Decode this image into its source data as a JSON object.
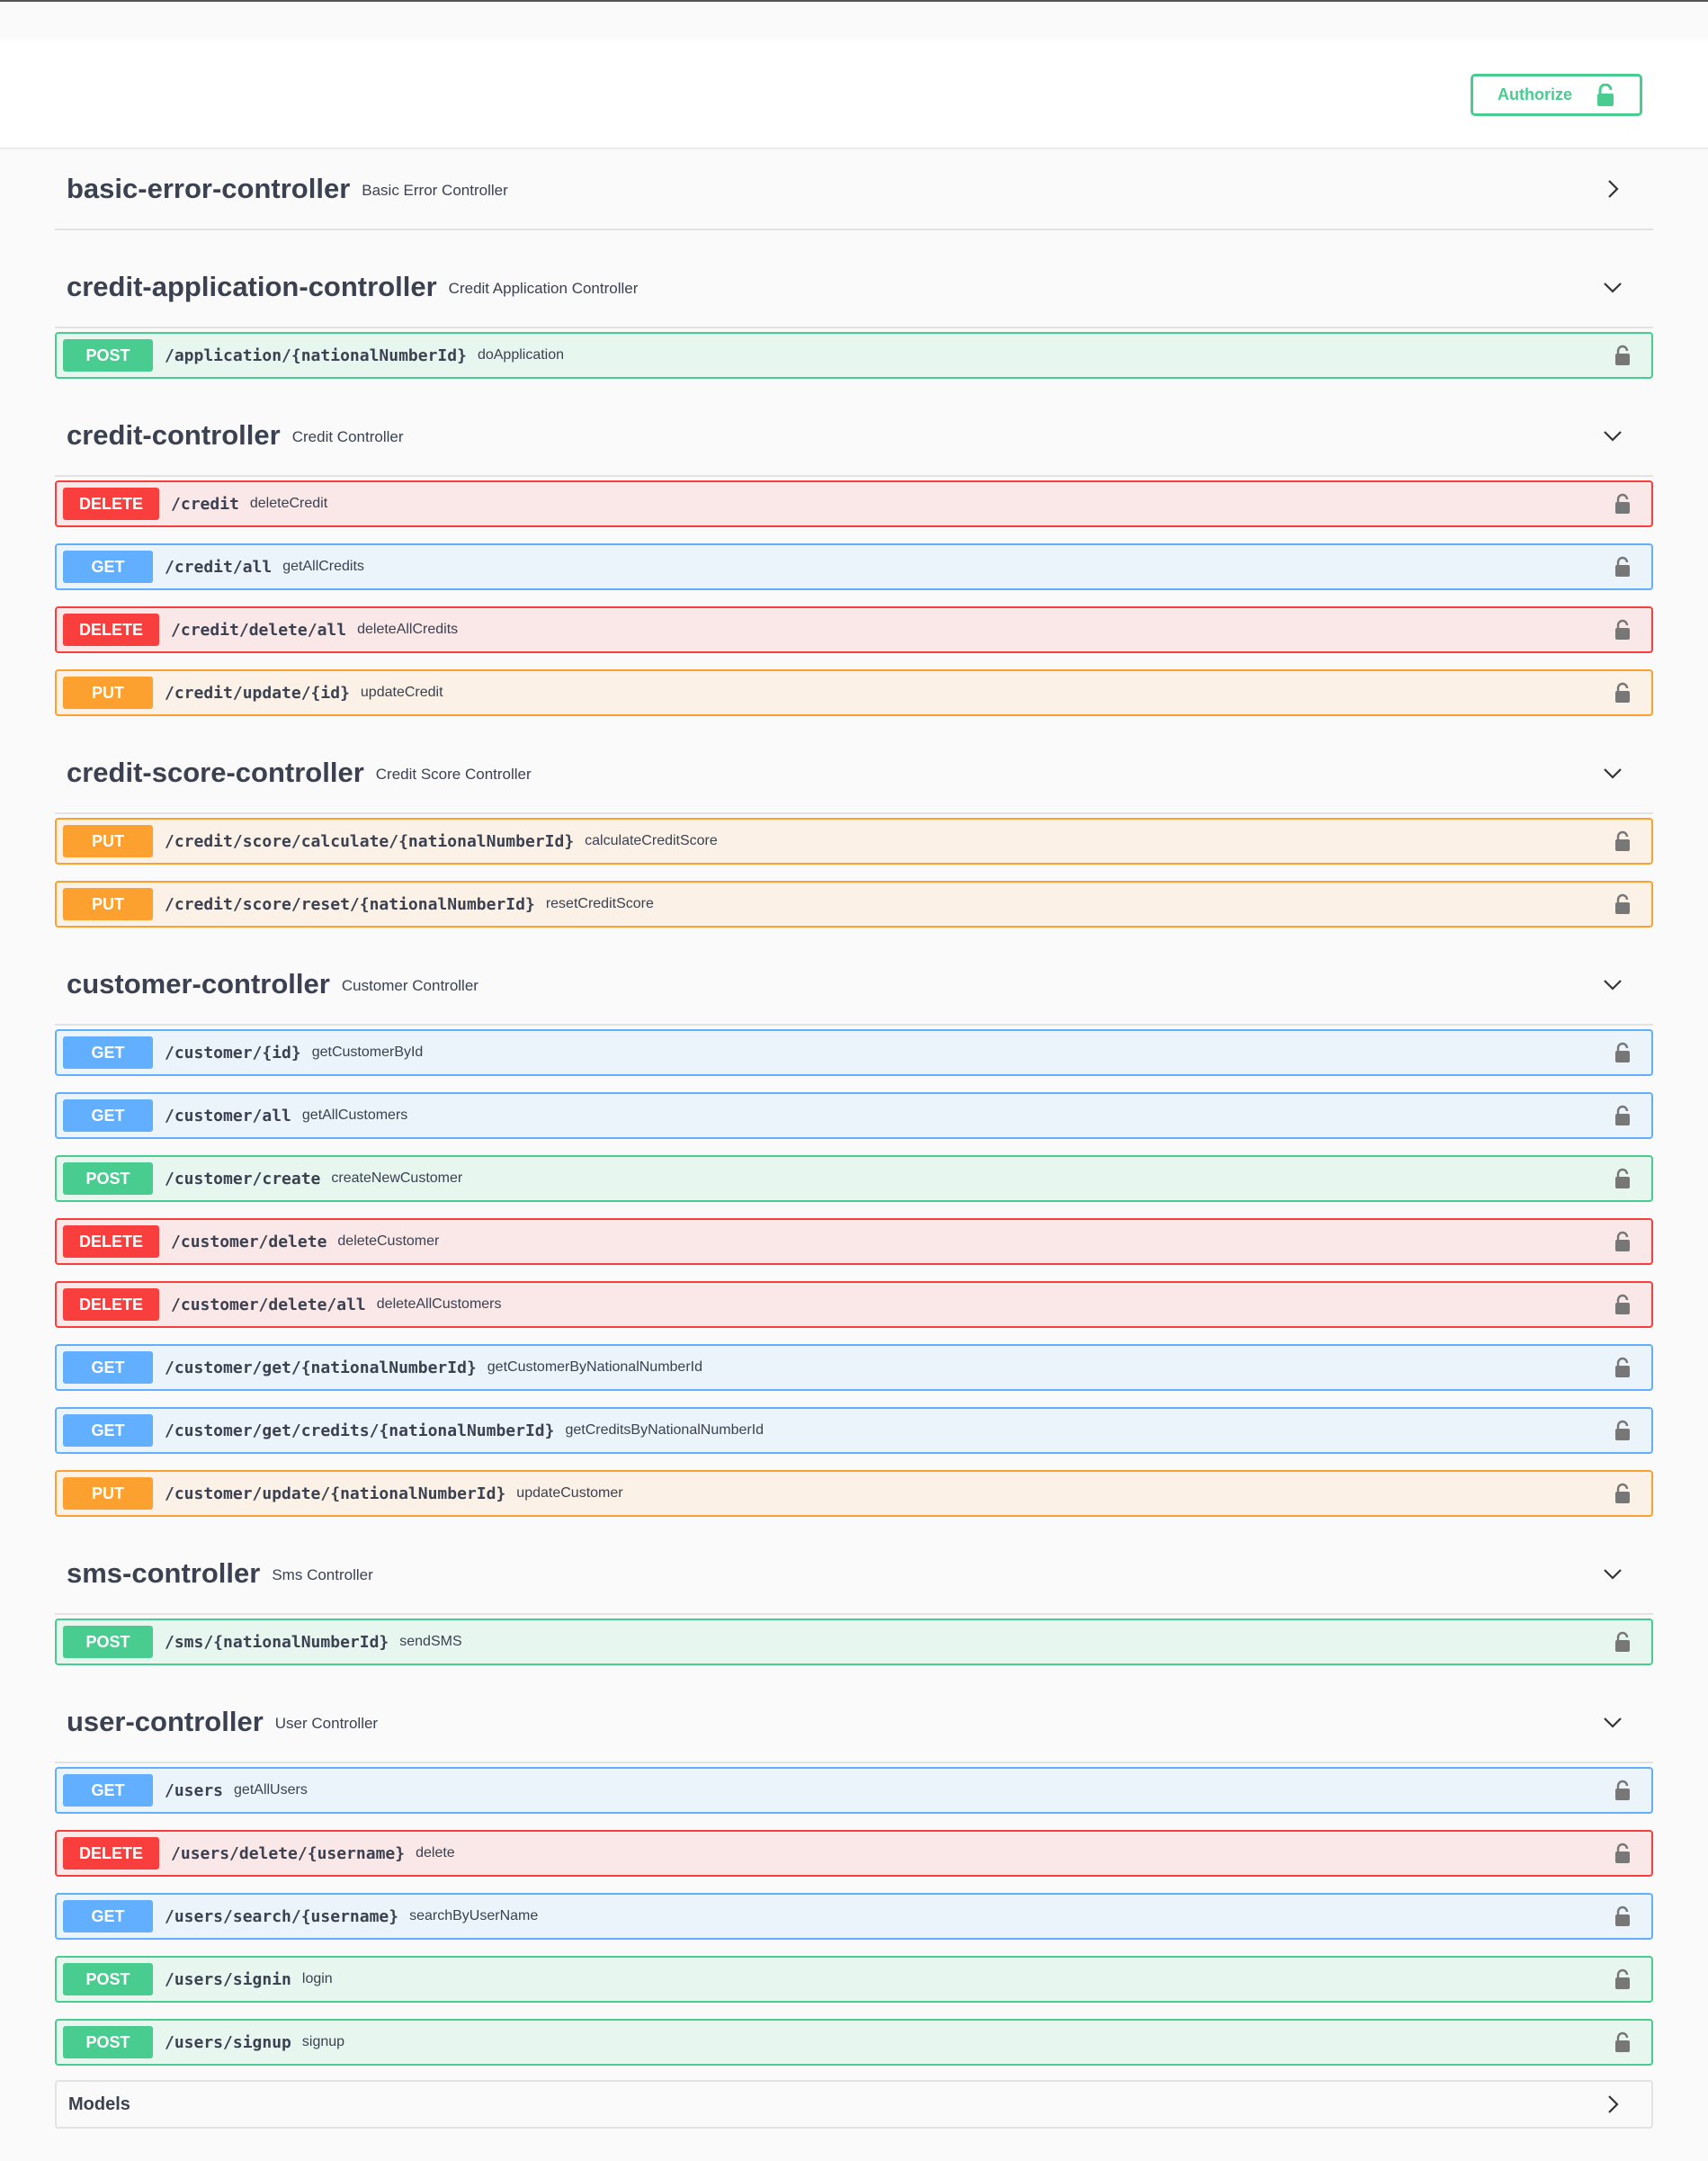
{
  "authorize": {
    "label": "Authorize",
    "color": "#49cc90",
    "icon": "unlocked-lock-icon"
  },
  "colors": {
    "post": "#49cc90",
    "get": "#61afe",
    "delete": "#f93e3e",
    "put": "#fca130"
  },
  "tags": [
    {
      "name": "basic-error-controller",
      "description": "Basic Error Controller",
      "expanded": false,
      "operations": []
    },
    {
      "name": "credit-application-controller",
      "description": "Credit Application Controller",
      "expanded": true,
      "operations": [
        {
          "method": "POST",
          "path": "/application/{nationalNumberId}",
          "summary": "doApplication"
        }
      ]
    },
    {
      "name": "credit-controller",
      "description": "Credit Controller",
      "expanded": true,
      "operations": [
        {
          "method": "DELETE",
          "path": "/credit",
          "summary": "deleteCredit"
        },
        {
          "method": "GET",
          "path": "/credit/all",
          "summary": "getAllCredits"
        },
        {
          "method": "DELETE",
          "path": "/credit/delete/all",
          "summary": "deleteAllCredits"
        },
        {
          "method": "PUT",
          "path": "/credit/update/{id}",
          "summary": "updateCredit"
        }
      ]
    },
    {
      "name": "credit-score-controller",
      "description": "Credit Score Controller",
      "expanded": true,
      "operations": [
        {
          "method": "PUT",
          "path": "/credit/score/calculate/{nationalNumberId}",
          "summary": "calculateCreditScore"
        },
        {
          "method": "PUT",
          "path": "/credit/score/reset/{nationalNumberId}",
          "summary": "resetCreditScore"
        }
      ]
    },
    {
      "name": "customer-controller",
      "description": "Customer Controller",
      "expanded": true,
      "operations": [
        {
          "method": "GET",
          "path": "/customer/{id}",
          "summary": "getCustomerById"
        },
        {
          "method": "GET",
          "path": "/customer/all",
          "summary": "getAllCustomers"
        },
        {
          "method": "POST",
          "path": "/customer/create",
          "summary": "createNewCustomer"
        },
        {
          "method": "DELETE",
          "path": "/customer/delete",
          "summary": "deleteCustomer"
        },
        {
          "method": "DELETE",
          "path": "/customer/delete/all",
          "summary": "deleteAllCustomers"
        },
        {
          "method": "GET",
          "path": "/customer/get/{nationalNumberId}",
          "summary": "getCustomerByNationalNumberId"
        },
        {
          "method": "GET",
          "path": "/customer/get/credits/{nationalNumberId}",
          "summary": "getCreditsByNationalNumberId"
        },
        {
          "method": "PUT",
          "path": "/customer/update/{nationalNumberId}",
          "summary": "updateCustomer"
        }
      ]
    },
    {
      "name": "sms-controller",
      "description": "Sms Controller",
      "expanded": true,
      "operations": [
        {
          "method": "POST",
          "path": "/sms/{nationalNumberId}",
          "summary": "sendSMS"
        }
      ]
    },
    {
      "name": "user-controller",
      "description": "User Controller",
      "expanded": true,
      "operations": [
        {
          "method": "GET",
          "path": "/users",
          "summary": "getAllUsers"
        },
        {
          "method": "DELETE",
          "path": "/users/delete/{username}",
          "summary": "delete"
        },
        {
          "method": "GET",
          "path": "/users/search/{username}",
          "summary": "searchByUserName"
        },
        {
          "method": "POST",
          "path": "/users/signin",
          "summary": "login"
        },
        {
          "method": "POST",
          "path": "/users/signup",
          "summary": "signup"
        }
      ]
    }
  ],
  "models": {
    "label": "Models",
    "expanded": false
  }
}
